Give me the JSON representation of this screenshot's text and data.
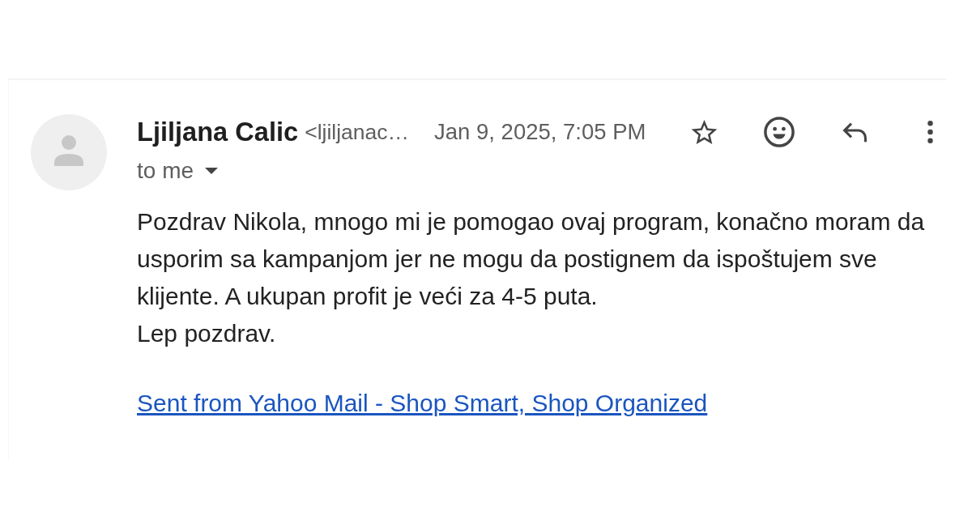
{
  "message": {
    "sender": {
      "name": "Ljiljana Calic",
      "email": "<ljiljanac…"
    },
    "date": "Jan 9, 2025, 7:05 PM",
    "starred": false,
    "recipient": "to me",
    "body": [
      "Pozdrav Nikola, mnogo mi je pomogao ovaj program, konačno moram da usporim sa kampanjom jer ne mogu da postignem da ispoštujem sve klijente. A ukupan profit je veći za 4-5 puta.",
      "Lep pozdrav."
    ],
    "signature_link": "Sent from Yahoo Mail - Shop Smart, Shop Organized"
  }
}
